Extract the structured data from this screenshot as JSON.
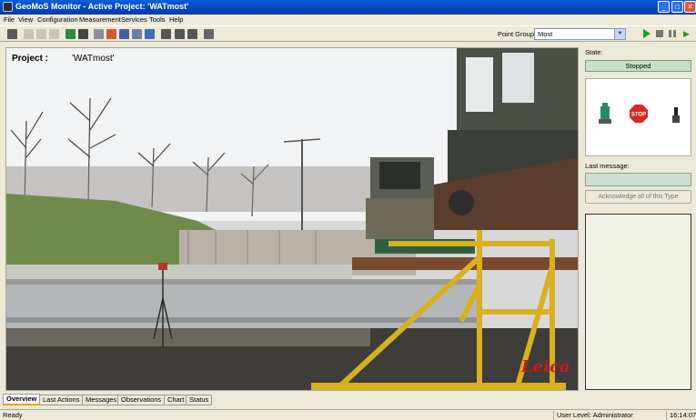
{
  "window": {
    "title": "GeoMoS Monitor - Active Project: 'WATmost'"
  },
  "menu": {
    "items": [
      "File",
      "View",
      "Configuration",
      "Measurement",
      "Services",
      "Tools",
      "Help"
    ]
  },
  "toolbar": {
    "point_group_label": "Point Group:",
    "point_group_value": "Most"
  },
  "main": {
    "project_label": "Project :",
    "project_value": "'WATmost'",
    "logo_text": "Leica"
  },
  "side_panel": {
    "state_label": "State:",
    "state_value": "Stopped",
    "stop_sign_text": "STOP",
    "last_message_label": "Last message:",
    "acknowledge_button": "Acknowledge all of this Type"
  },
  "tabs": [
    "Overview",
    "Last Actions",
    "Messages",
    "Observations",
    "Chart",
    "Status"
  ],
  "status_bar": {
    "left": "Ready",
    "user_level": "User Level: Administrator",
    "time": "16:14:07"
  },
  "colors": {
    "titlebar": "#0842b5",
    "state_bg": "#c7dfc9",
    "accent_play": "#1f9d2a",
    "leica_red": "#d1161d"
  }
}
